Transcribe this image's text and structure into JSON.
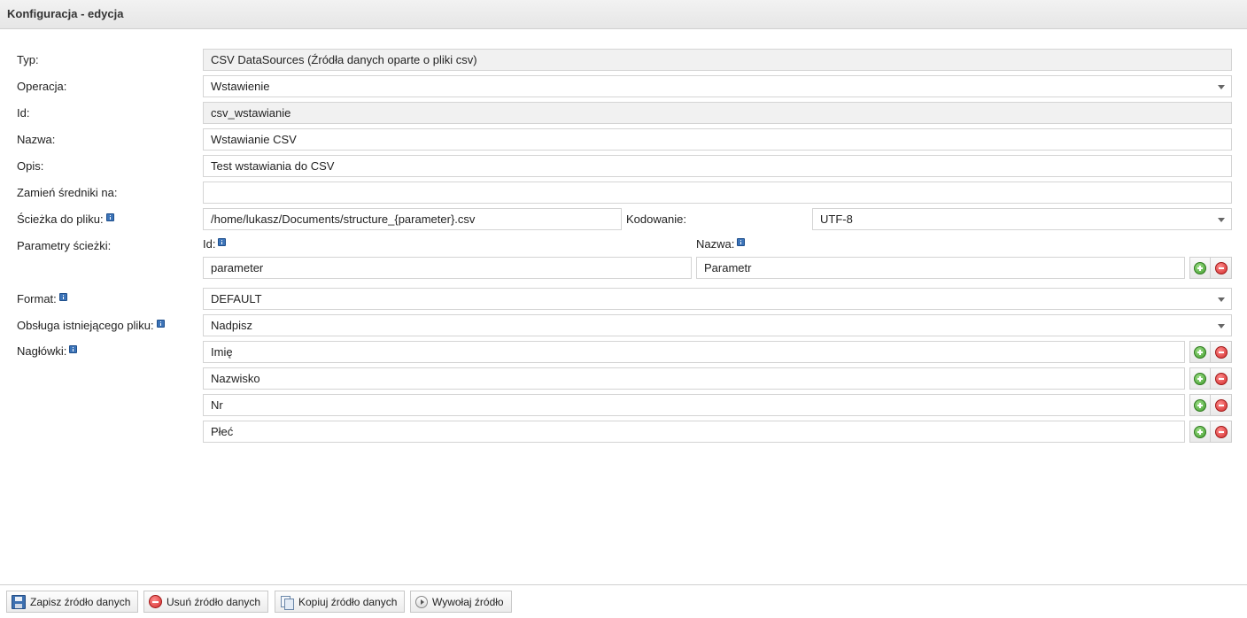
{
  "window": {
    "title": "Konfiguracja - edycja"
  },
  "form": {
    "typ": {
      "label": "Typ:",
      "value": "CSV DataSources (Źródła danych oparte o pliki csv)"
    },
    "operacja": {
      "label": "Operacja:",
      "value": "Wstawienie"
    },
    "id": {
      "label": "Id:",
      "value": "csv_wstawianie"
    },
    "nazwa": {
      "label": "Nazwa:",
      "value": "Wstawianie CSV"
    },
    "opis": {
      "label": "Opis:",
      "value": "Test wstawiania do CSV"
    },
    "zamien": {
      "label": "Zamień średniki na:",
      "value": ""
    },
    "sciezka": {
      "label": "Ścieżka do pliku:",
      "value": "/home/lukasz/Documents/structure_{parameter}.csv"
    },
    "kodowanie": {
      "label": "Kodowanie:",
      "value": "UTF-8"
    },
    "parametry": {
      "label": "Parametry ścieżki:",
      "id_label": "Id:",
      "nazwa_label": "Nazwa:",
      "rows": [
        {
          "id": "parameter",
          "nazwa": "Parametr"
        }
      ]
    },
    "format": {
      "label": "Format:",
      "value": "DEFAULT"
    },
    "obsluga": {
      "label": "Obsługa istniejącego pliku:",
      "value": "Nadpisz"
    },
    "naglowki": {
      "label": "Nagłówki:",
      "items": [
        "Imię",
        "Nazwisko",
        "Nr",
        "Płeć"
      ]
    }
  },
  "footer": {
    "save": "Zapisz źródło danych",
    "delete": "Usuń źródło danych",
    "copy": "Kopiuj źródło danych",
    "invoke": "Wywołaj źródło"
  },
  "icons": {
    "help": "info-help-icon",
    "add": "add-circle-icon",
    "remove": "remove-circle-icon",
    "save": "floppy-disk-icon",
    "delete": "delete-circle-icon",
    "copy": "copy-documents-icon",
    "invoke": "play-circle-icon"
  }
}
